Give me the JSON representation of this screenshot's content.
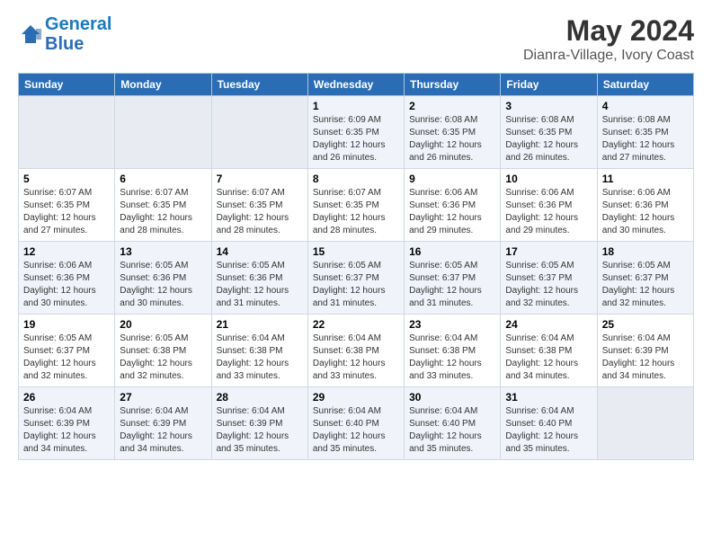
{
  "header": {
    "logo_line1": "General",
    "logo_line2": "Blue",
    "main_title": "May 2024",
    "subtitle": "Dianra-Village, Ivory Coast"
  },
  "days_of_week": [
    "Sunday",
    "Monday",
    "Tuesday",
    "Wednesday",
    "Thursday",
    "Friday",
    "Saturday"
  ],
  "weeks": [
    [
      {
        "day": "",
        "info": ""
      },
      {
        "day": "",
        "info": ""
      },
      {
        "day": "",
        "info": ""
      },
      {
        "day": "1",
        "info": "Sunrise: 6:09 AM\nSunset: 6:35 PM\nDaylight: 12 hours\nand 26 minutes."
      },
      {
        "day": "2",
        "info": "Sunrise: 6:08 AM\nSunset: 6:35 PM\nDaylight: 12 hours\nand 26 minutes."
      },
      {
        "day": "3",
        "info": "Sunrise: 6:08 AM\nSunset: 6:35 PM\nDaylight: 12 hours\nand 26 minutes."
      },
      {
        "day": "4",
        "info": "Sunrise: 6:08 AM\nSunset: 6:35 PM\nDaylight: 12 hours\nand 27 minutes."
      }
    ],
    [
      {
        "day": "5",
        "info": "Sunrise: 6:07 AM\nSunset: 6:35 PM\nDaylight: 12 hours\nand 27 minutes."
      },
      {
        "day": "6",
        "info": "Sunrise: 6:07 AM\nSunset: 6:35 PM\nDaylight: 12 hours\nand 28 minutes."
      },
      {
        "day": "7",
        "info": "Sunrise: 6:07 AM\nSunset: 6:35 PM\nDaylight: 12 hours\nand 28 minutes."
      },
      {
        "day": "8",
        "info": "Sunrise: 6:07 AM\nSunset: 6:35 PM\nDaylight: 12 hours\nand 28 minutes."
      },
      {
        "day": "9",
        "info": "Sunrise: 6:06 AM\nSunset: 6:36 PM\nDaylight: 12 hours\nand 29 minutes."
      },
      {
        "day": "10",
        "info": "Sunrise: 6:06 AM\nSunset: 6:36 PM\nDaylight: 12 hours\nand 29 minutes."
      },
      {
        "day": "11",
        "info": "Sunrise: 6:06 AM\nSunset: 6:36 PM\nDaylight: 12 hours\nand 30 minutes."
      }
    ],
    [
      {
        "day": "12",
        "info": "Sunrise: 6:06 AM\nSunset: 6:36 PM\nDaylight: 12 hours\nand 30 minutes."
      },
      {
        "day": "13",
        "info": "Sunrise: 6:05 AM\nSunset: 6:36 PM\nDaylight: 12 hours\nand 30 minutes."
      },
      {
        "day": "14",
        "info": "Sunrise: 6:05 AM\nSunset: 6:36 PM\nDaylight: 12 hours\nand 31 minutes."
      },
      {
        "day": "15",
        "info": "Sunrise: 6:05 AM\nSunset: 6:37 PM\nDaylight: 12 hours\nand 31 minutes."
      },
      {
        "day": "16",
        "info": "Sunrise: 6:05 AM\nSunset: 6:37 PM\nDaylight: 12 hours\nand 31 minutes."
      },
      {
        "day": "17",
        "info": "Sunrise: 6:05 AM\nSunset: 6:37 PM\nDaylight: 12 hours\nand 32 minutes."
      },
      {
        "day": "18",
        "info": "Sunrise: 6:05 AM\nSunset: 6:37 PM\nDaylight: 12 hours\nand 32 minutes."
      }
    ],
    [
      {
        "day": "19",
        "info": "Sunrise: 6:05 AM\nSunset: 6:37 PM\nDaylight: 12 hours\nand 32 minutes."
      },
      {
        "day": "20",
        "info": "Sunrise: 6:05 AM\nSunset: 6:38 PM\nDaylight: 12 hours\nand 32 minutes."
      },
      {
        "day": "21",
        "info": "Sunrise: 6:04 AM\nSunset: 6:38 PM\nDaylight: 12 hours\nand 33 minutes."
      },
      {
        "day": "22",
        "info": "Sunrise: 6:04 AM\nSunset: 6:38 PM\nDaylight: 12 hours\nand 33 minutes."
      },
      {
        "day": "23",
        "info": "Sunrise: 6:04 AM\nSunset: 6:38 PM\nDaylight: 12 hours\nand 33 minutes."
      },
      {
        "day": "24",
        "info": "Sunrise: 6:04 AM\nSunset: 6:38 PM\nDaylight: 12 hours\nand 34 minutes."
      },
      {
        "day": "25",
        "info": "Sunrise: 6:04 AM\nSunset: 6:39 PM\nDaylight: 12 hours\nand 34 minutes."
      }
    ],
    [
      {
        "day": "26",
        "info": "Sunrise: 6:04 AM\nSunset: 6:39 PM\nDaylight: 12 hours\nand 34 minutes."
      },
      {
        "day": "27",
        "info": "Sunrise: 6:04 AM\nSunset: 6:39 PM\nDaylight: 12 hours\nand 34 minutes."
      },
      {
        "day": "28",
        "info": "Sunrise: 6:04 AM\nSunset: 6:39 PM\nDaylight: 12 hours\nand 35 minutes."
      },
      {
        "day": "29",
        "info": "Sunrise: 6:04 AM\nSunset: 6:40 PM\nDaylight: 12 hours\nand 35 minutes."
      },
      {
        "day": "30",
        "info": "Sunrise: 6:04 AM\nSunset: 6:40 PM\nDaylight: 12 hours\nand 35 minutes."
      },
      {
        "day": "31",
        "info": "Sunrise: 6:04 AM\nSunset: 6:40 PM\nDaylight: 12 hours\nand 35 minutes."
      },
      {
        "day": "",
        "info": ""
      }
    ]
  ]
}
